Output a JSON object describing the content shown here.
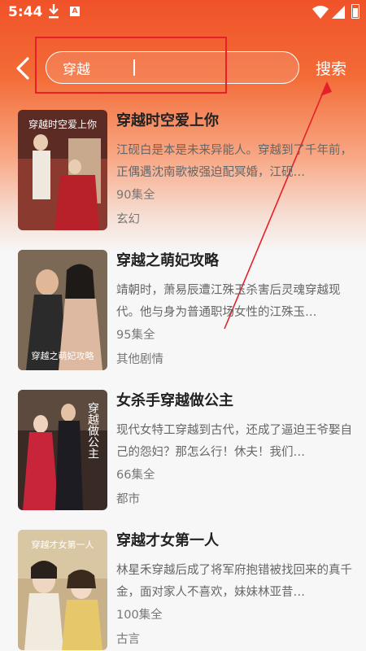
{
  "status_bar": {
    "time": "5:44",
    "icons": [
      "download-icon",
      "a-badge-icon",
      "wifi-icon",
      "signal-icon",
      "battery-icon"
    ]
  },
  "search": {
    "value": "穿越",
    "button_label": "搜索"
  },
  "colors": {
    "header_accent": "#f15a2e",
    "annotation": "#e5202a"
  },
  "results": [
    {
      "title": "穿越时空爱上你",
      "desc": "江砚白是本是未来异能人。穿越到了千年前，正偶遇沈南歌被强迫配冥婚，江砚…",
      "episodes": "90集全",
      "genre": "玄幻",
      "cover_text": "穿越时空爱上你"
    },
    {
      "title": "穿越之萌妃攻略",
      "desc": "靖朝时，萧易辰遭江殊玉杀害后灵魂穿越现代。他与身为普通职场女性的江殊玉…",
      "episodes": "95集全",
      "genre": "其他剧情",
      "cover_text": "穿越之萌妃攻略"
    },
    {
      "title": "女杀手穿越做公主",
      "desc": "现代女特工穿越到古代，还成了逼迫王爷娶自己的怨妇？那怎么行！休夫！我们…",
      "episodes": "66集全",
      "genre": "都市",
      "cover_text": "穿越做公主"
    },
    {
      "title": "穿越才女第一人",
      "desc": "林星禾穿越后成了将军府抱错被找回来的真千金，面对家人不喜欢，妹妹林亚昔…",
      "episodes": "100集全",
      "genre": "古言",
      "cover_text": "穿越才女第一人"
    }
  ]
}
